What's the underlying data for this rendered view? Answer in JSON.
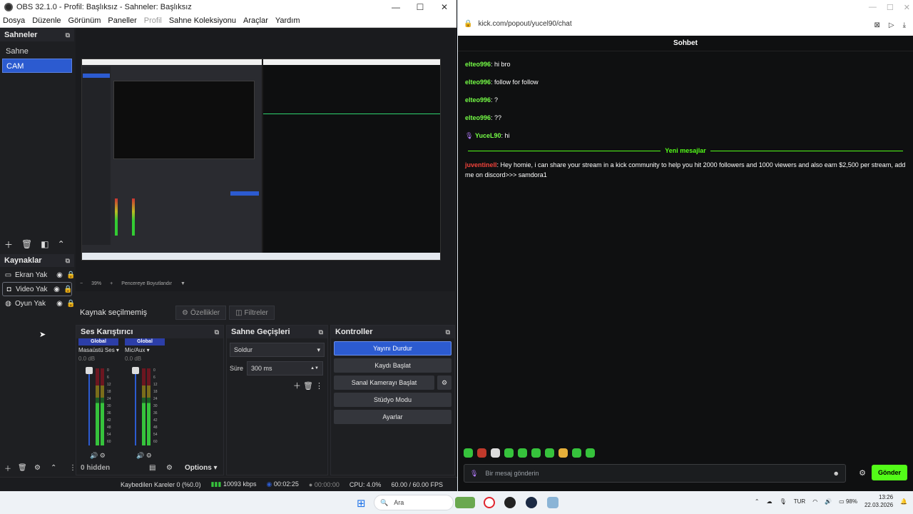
{
  "obs": {
    "title": "OBS 32.1.0 - Profil: Başlıksız - Sahneler: Başlıksız",
    "menu": [
      "Dosya",
      "Düzenle",
      "Görünüm",
      "Paneller",
      "Profil",
      "Sahne Koleksiyonu",
      "Araçlar",
      "Yardım"
    ],
    "scenes": {
      "title": "Sahneler",
      "items": [
        "Sahne",
        "CAM"
      ],
      "active": "CAM"
    },
    "sources": {
      "title": "Kaynaklar",
      "items": [
        {
          "name": "Ekran Yak",
          "icon": "monitor-icon"
        },
        {
          "name": "Video Yak",
          "icon": "camera-icon"
        },
        {
          "name": "Oyun Yak",
          "icon": "gamepad-icon"
        }
      ]
    },
    "preview": {
      "zoom": "39%",
      "fit_label": "Pencereye Boyutlandır"
    },
    "source_toolbar": {
      "label": "Kaynak seçilmemiş",
      "properties": "Özellikler",
      "filters": "Filtreler"
    },
    "mixer": {
      "title": "Ses Karıştırıcı",
      "channels": [
        {
          "badge": "Global",
          "name": "Masaüstü Ses",
          "db": "0.0 dB"
        },
        {
          "badge": "Global",
          "name": "Mic/Aux",
          "db": "0.0 dB"
        }
      ],
      "scale": [
        "0",
        "6",
        "12",
        "18",
        "24",
        "30",
        "36",
        "42",
        "48",
        "54",
        "60"
      ]
    },
    "transitions": {
      "title": "Sahne Geçişleri",
      "selected": "Soldur",
      "duration_label": "Süre",
      "duration": "300 ms"
    },
    "controls": {
      "title": "Kontroller",
      "stream": "Yayını Durdur",
      "record": "Kaydı Başlat",
      "virtualcam": "Sanal Kamerayı Başlat",
      "studio": "Stüdyo Modu",
      "settings": "Ayarlar"
    },
    "bottom": {
      "hidden": "0 hidden",
      "options": "Options"
    },
    "status": {
      "dropped": "Kaybedilen Kareler 0 (%0.0)",
      "bitrate": "10093 kbps",
      "stream_time": "00:02:25",
      "rec_time": "00:00:00",
      "cpu": "CPU: 4.0%",
      "fps": "60.00 / 60.00 FPS"
    }
  },
  "browser": {
    "url": "kick.com/popout/yucel90/chat",
    "chat_title": "Sohbet",
    "messages": [
      {
        "user": "elteo996",
        "text": "hi bro",
        "color": "#75fd46"
      },
      {
        "user": "elteo996",
        "text": "follow for follow",
        "color": "#75fd46"
      },
      {
        "user": "elteo996",
        "text": "?",
        "color": "#75fd46"
      },
      {
        "user": "elteo996",
        "text": "??",
        "color": "#75fd46"
      },
      {
        "user": "YuceL90",
        "text": "hi",
        "color": "#75fd46"
      }
    ],
    "new_messages": "Yeni mesajlar",
    "spam": {
      "user": "juventinell",
      "text": "Hey homie, i can share your stream in a kick community to help you hit 2000 followers and 1000 viewers and also earn $2,500 per stream, add me on discord>>> samdora1",
      "color": "#f2433b"
    },
    "input_placeholder": "Bir mesaj gönderin",
    "send": "Gönder"
  },
  "taskbar": {
    "search": "Ara",
    "lang": "TUR",
    "battery": "98%",
    "time": "13:26",
    "date": "22.03.2026"
  }
}
